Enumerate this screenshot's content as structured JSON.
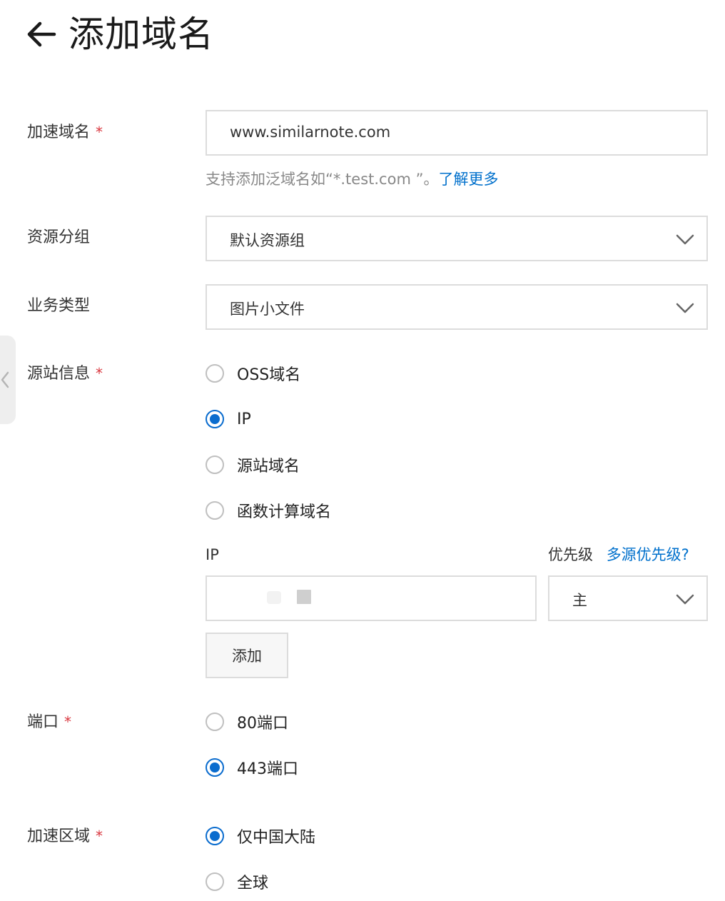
{
  "page": {
    "title": "添加域名"
  },
  "form": {
    "domain": {
      "label": "加速域名",
      "required": "*",
      "value": "www.similarnote.com",
      "hint_text": "支持添加泛域名如“*.test.com ”。",
      "hint_link": "了解更多"
    },
    "resource_group": {
      "label": "资源分组",
      "value": "默认资源组"
    },
    "business_type": {
      "label": "业务类型",
      "value": "图片小文件"
    },
    "origin": {
      "label": "源站信息",
      "required": "*",
      "options": [
        {
          "label": "OSS域名",
          "checked": false
        },
        {
          "label": "IP",
          "checked": true
        },
        {
          "label": "源站域名",
          "checked": false
        },
        {
          "label": "函数计算域名",
          "checked": false
        }
      ],
      "ip_label": "IP",
      "priority_label": "优先级",
      "multi_priority_link": "多源优先级?",
      "ip_value": "",
      "priority_value": "主",
      "add_button": "添加"
    },
    "port": {
      "label": "端口",
      "required": "*",
      "options": [
        {
          "label": "80端口",
          "checked": false
        },
        {
          "label": "443端口",
          "checked": true
        }
      ]
    },
    "region": {
      "label": "加速区域",
      "required": "*",
      "options": [
        {
          "label": "仅中国大陆",
          "checked": true
        },
        {
          "label": "全球",
          "checked": false
        }
      ]
    }
  },
  "colors": {
    "accent": "#0a6cce",
    "link": "#0070cc",
    "required": "#d9363e",
    "border": "#dcdcdc"
  },
  "icons": {
    "back": "arrow-left-icon",
    "dropdown": "chevron-down-icon",
    "side_handle": "chevron-left-icon"
  }
}
